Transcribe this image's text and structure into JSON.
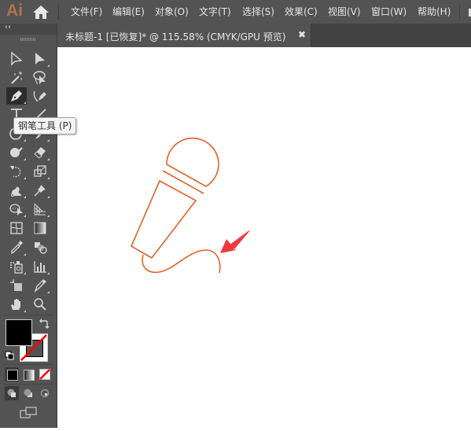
{
  "app": {
    "logo": "Ai",
    "accent_color": "#b5734c"
  },
  "menu": {
    "items": [
      {
        "label": "文件(F)"
      },
      {
        "label": "编辑(E)"
      },
      {
        "label": "对象(O)"
      },
      {
        "label": "文字(T)"
      },
      {
        "label": "选择(S)"
      },
      {
        "label": "效果(C)"
      },
      {
        "label": "视图(V)"
      },
      {
        "label": "窗口(W)"
      },
      {
        "label": "帮助(H)"
      }
    ]
  },
  "document_tab": {
    "title": "未标题-1 [已恢复]* @ 115.58% (CMYK/GPU 预览)",
    "close": "✖"
  },
  "tools_panel": {
    "collapse_label": "‹‹",
    "tools": [
      {
        "name": "selection-tool"
      },
      {
        "name": "direct-selection-tool"
      },
      {
        "name": "magic-wand-tool"
      },
      {
        "name": "lasso-tool"
      },
      {
        "name": "pen-tool",
        "active": true
      },
      {
        "name": "curvature-tool"
      },
      {
        "name": "type-tool"
      },
      {
        "name": "line-segment-tool"
      },
      {
        "name": "ellipse-tool"
      },
      {
        "name": "paintbrush-tool"
      },
      {
        "name": "shaper-tool"
      },
      {
        "name": "eraser-tool"
      },
      {
        "name": "rotate-tool"
      },
      {
        "name": "scale-tool"
      },
      {
        "name": "warp-tool"
      },
      {
        "name": "puppet-warp-tool"
      },
      {
        "name": "shape-builder-tool"
      },
      {
        "name": "perspective-grid-tool"
      },
      {
        "name": "mesh-tool"
      },
      {
        "name": "gradient-tool"
      },
      {
        "name": "eyedropper-tool"
      },
      {
        "name": "blend-tool"
      },
      {
        "name": "symbol-sprayer-tool"
      },
      {
        "name": "column-graph-tool"
      },
      {
        "name": "artboard-tool"
      },
      {
        "name": "slice-tool"
      },
      {
        "name": "hand-tool"
      },
      {
        "name": "zoom-tool"
      }
    ],
    "tooltip": "钢笔工具 (P)",
    "fill_color": "#000000",
    "stroke_color": "none",
    "none_color": "#ff0000"
  },
  "canvas": {
    "stroke_color": "#e0622a",
    "arrow_color": "#f0383d"
  }
}
